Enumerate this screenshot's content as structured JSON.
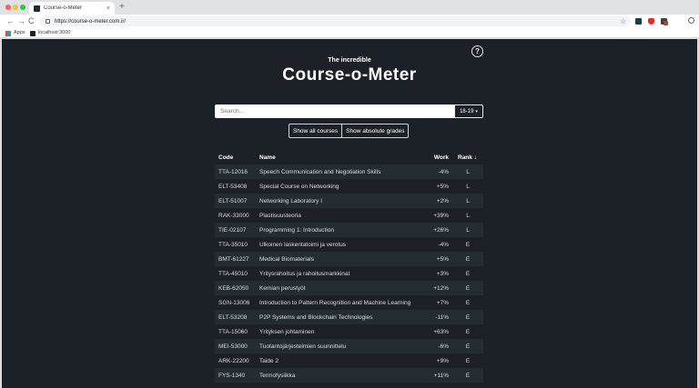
{
  "browser": {
    "tab_title": "Course-o-Meter",
    "tab_close": "×",
    "new_tab": "+",
    "url": "https://course-o-meter.com.ir/",
    "bookmarks": [
      "Apps",
      "localhost:3000"
    ],
    "nav_back": "←",
    "nav_forward": "→",
    "nav_reload": "C",
    "star": "☆"
  },
  "page": {
    "help_label": "?",
    "subtitle": "The incredible",
    "title": "Course-o-Meter",
    "search_placeholder": "Search...",
    "year_selected": "18-19",
    "year_caret": "▾",
    "buttons": [
      "Show all courses",
      "Show absolute grades"
    ],
    "columns": {
      "code": "Code",
      "name": "Name",
      "work": "Work",
      "rank": "Rank ↓"
    },
    "rows": [
      {
        "code": "TTA-12016",
        "name": "Speech Communication and Negotiation Skills",
        "work": "-4%",
        "rank": "L"
      },
      {
        "code": "ELT-53408",
        "name": "Special Course on Networking",
        "work": "+5%",
        "rank": "L"
      },
      {
        "code": "ELT-51007",
        "name": "Networking Laboratory I",
        "work": "+2%",
        "rank": "L"
      },
      {
        "code": "RAK-33000",
        "name": "Plastisuusteoria",
        "work": "+39%",
        "rank": "L"
      },
      {
        "code": "TIE-02107",
        "name": "Programming 1: Introduction",
        "work": "+26%",
        "rank": "L"
      },
      {
        "code": "TTA-35010",
        "name": "Ulkoinen laskentatoimi ja verotus",
        "work": "-4%",
        "rank": "E"
      },
      {
        "code": "BMT-61227",
        "name": "Medical Biomaterials",
        "work": "+5%",
        "rank": "E"
      },
      {
        "code": "TTA-45010",
        "name": "Yritysrahoitus ja rahoitusmarkkinat",
        "work": "+3%",
        "rank": "E"
      },
      {
        "code": "KEB-62050",
        "name": "Kemian perustyöt",
        "work": "+12%",
        "rank": "E"
      },
      {
        "code": "SGN-13006",
        "name": "Introduction to Pattern Recognition and Machine Learning",
        "work": "+7%",
        "rank": "E"
      },
      {
        "code": "ELT-53208",
        "name": "P2P Systems and Blockchain Technologies",
        "work": "-11%",
        "rank": "E"
      },
      {
        "code": "TTA-15060",
        "name": "Yrityksen johtaminen",
        "work": "+63%",
        "rank": "E"
      },
      {
        "code": "MEI-53000",
        "name": "Tuotantojärjestelmien suunnittelu",
        "work": "-6%",
        "rank": "E"
      },
      {
        "code": "ARK-22200",
        "name": "Taide 2",
        "work": "+9%",
        "rank": "E"
      },
      {
        "code": "FYS-1340",
        "name": "Termofysiikka",
        "work": "+11%",
        "rank": "E"
      }
    ]
  }
}
